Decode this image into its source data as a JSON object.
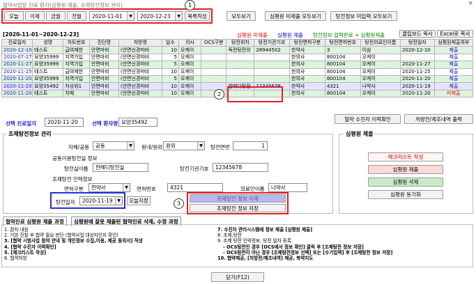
{
  "window": {
    "title": "협약사업장 진료 환자(심평원 제출, 조제탕전정보 관리)",
    "close": "×"
  },
  "toolbar": {
    "today": "오늘",
    "this_week": "이제",
    "this_month": "금월",
    "all": "전월",
    "date_from": "2020-11-01",
    "date_to": "2020-12-23",
    "list_btn": "목록작성"
  },
  "right_toolbar": {
    "view_all": "모두보기",
    "hira_unsubmitted": "심평원 미제출 모두보기",
    "decoction_uninput": "탕전정보 미입력 모두보기"
  },
  "legend": {
    "range": "[2020-11-01~2020-12-23]",
    "unsubmitted": "심평원 미제출",
    "submitted": "심평원 제출",
    "decoction_done": "탕전정보 입력완료 + 심평원제출",
    "clipboard": "클립보드 복사",
    "excel": "Excel로 복사"
  },
  "table": {
    "columns": [
      "진료일자",
      "성명",
      "차트번호",
      "진단명",
      "처방명",
      "일수",
      "의사",
      "OCS구분",
      "탕전위치",
      "탕전기관기호",
      "탕전면허구분",
      "탕전면허번호",
      "탕전의료인이름",
      "탕전일자",
      "심평원제출여부"
    ],
    "rows": [
      [
        "2020-12-10",
        "테스트",
        "급여제한",
        "안면마비",
        "(안면신경마비",
        "10",
        "오케이",
        "",
        "독전탕전의",
        "28944502",
        "한약사",
        "3",
        "이삼",
        "2020-12-10",
        "제출"
      ],
      [
        "2020-07-27",
        "요양35999",
        "지역가입",
        "안면마비",
        "(안면신경마비",
        "5",
        "오케이",
        "",
        "",
        "",
        "한의사",
        "800104",
        "오케이",
        "",
        "제출"
      ],
      [
        "2020-11-27",
        "요양35999",
        "지역가입",
        "안면마비",
        "(안면신경마비",
        "5",
        "오케이",
        "",
        "",
        "",
        "한의사",
        "800104",
        "오케이",
        "2020-11-27",
        "제출"
      ],
      [
        "2020-11-25",
        "테스트",
        "급여제한",
        "안면마비",
        "(안면신경마비",
        "10",
        "오케이",
        "",
        "",
        "",
        "한의사",
        "800104",
        "오케이",
        "2020-11-25",
        "제출"
      ],
      [
        "2020-11-20",
        "요양35999",
        "지역가입",
        "안면마비",
        "(안면신경마비",
        "5",
        "오케이",
        "",
        "",
        "",
        "한의사",
        "800104",
        "오케이",
        "2020-11-20",
        "제출"
      ],
      [
        "2020-11-20",
        "요양35492",
        "차상위1",
        "안면마비",
        "(안면신경마비",
        "10",
        "오케이",
        "",
        "한메디탕전",
        "12345678",
        "한약사",
        "4321",
        "나약사",
        "2020-11-19",
        "제출"
      ],
      [
        "2020-11-20",
        "테스트",
        "치매",
        "안면마비",
        "(안면신경마비",
        "10",
        "오케이",
        "",
        "",
        "",
        "한의사",
        "800104",
        "오케이",
        "2020-11-20",
        "미제출"
      ]
    ]
  },
  "selected": {
    "date_label": "선택 진료일자",
    "date": "2020-11-20",
    "patient_label": "선택 환자명",
    "patient": "요양35492"
  },
  "right_top_buttons": {
    "receiver_history": "협약 수진자 이력확인",
    "prescription_print": "처방전/제조내역 출력"
  },
  "decoction": {
    "title": "조제탕전정보 관리",
    "self_label": "자체/공동",
    "self_value": "공동",
    "inout_label": "원내/원외",
    "inout_value": "원외",
    "serial_label": "탕전연번",
    "serial_value": "1",
    "shared_label": "공동이용탕전실 정보",
    "room_name_label": "탕전실이름",
    "room_name": "한메디탕전실",
    "org_code_label": "탕전기관기호",
    "org_code": "12345678",
    "person_label": "조제탕전 인력정보",
    "license_type_label": "면허구분",
    "license_type": "한약사",
    "license_no_label": "면허번호",
    "license_no": "4321",
    "person_name_label": "의료인이름",
    "person_name": "나약사",
    "date_label": "탕전일자",
    "date": "2020-11-19",
    "today_btn": "오늘지정",
    "del_btn": "조제탕전 정보 삭제",
    "save_btn": "조제탕전 정보 저장"
  },
  "hira": {
    "title": "심평원 제출",
    "checklist": "체크리스트 작성",
    "submit": "심평원 제출",
    "delete": "심평원 삭제",
    "sync": "심평원 동기화"
  },
  "tabs": {
    "t1": "협약진료 심평원 제출 과정",
    "t2": "심평원에 잘못 제출된 협약진료 삭제, 수정 과정"
  },
  "help_left": [
    "1. 환자 내원",
    "2. 기본 진찰 후 협약 필요 판단 (협약사업 대상자인지 확인)",
    "3. [협약 시범사업 참여 안내 및 개인정보 수집,이용, 제공 동의서] 작성",
    "4. [협약 수진자 이력확인]",
    "5. [체크리스트 작성]",
    "6. 협약처방"
  ],
  "help_right": [
    "7. 수진자 관리시스템에 정보 제출 [심평원 제출]",
    "8. 조제,탕전",
    "9. 조제 탕전 인력정보, 탕전 일자 등록",
    "- OCS탕전인 경우 [OCS에서 정보 확인] 클릭 후 [조제탕전 정보 저장]",
    "- OCS탕전이 아닌 경우 [조제탕전정보 선택] 또는 [수기입력] 후 [조제탕전 정보 저장]",
    "10. 협약제공, [처방전/제조내역] 제공, 복약지도"
  ],
  "close_btn": "닫기(F12)",
  "annotations": {
    "c1": "1",
    "c2": "2",
    "c3": "3"
  },
  "colors": {
    "unsubmitted": "#e00000",
    "submitted": "#0000cc",
    "done": "#008000",
    "accent": "#e02020"
  }
}
